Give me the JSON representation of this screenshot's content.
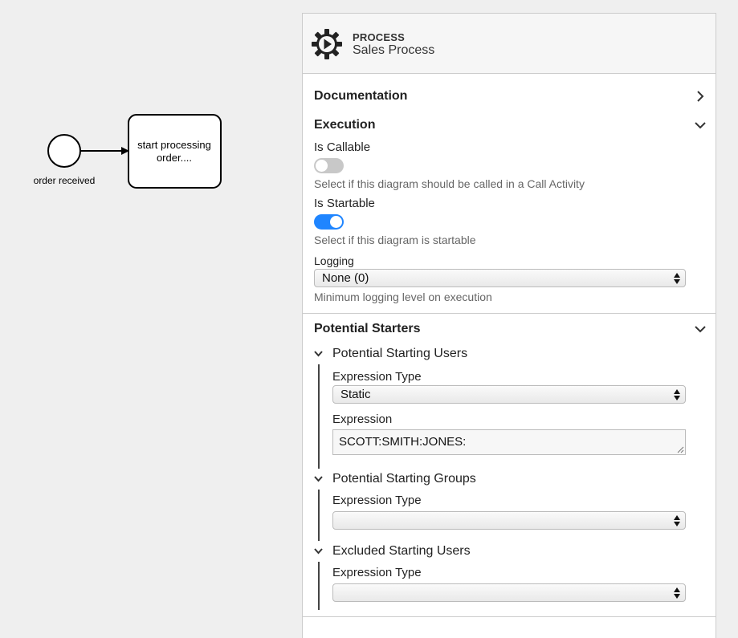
{
  "canvas": {
    "start_event_label": "order received",
    "task_label_line1": "start processing",
    "task_label_line2": "order...."
  },
  "panel": {
    "header": {
      "icon": "process-gear-icon",
      "type": "PROCESS",
      "name": "Sales Process"
    },
    "documentation": {
      "title": "Documentation",
      "icon": "chevron-right-icon"
    },
    "execution": {
      "title": "Execution",
      "icon": "chevron-down-icon",
      "is_callable": {
        "label": "Is Callable",
        "checked": false,
        "description": "Select if this diagram should be called in a Call Activity"
      },
      "is_startable": {
        "label": "Is Startable",
        "checked": true,
        "description": "Select if this diagram is startable"
      },
      "logging": {
        "label": "Logging",
        "value": "None (0)",
        "description": "Minimum logging level on execution"
      }
    },
    "potential_starters": {
      "title": "Potential Starters",
      "icon": "chevron-down-icon",
      "users": {
        "title": "Potential Starting Users",
        "expression_type_label": "Expression Type",
        "expression_type_value": "Static",
        "expression_label": "Expression",
        "expression_value": "SCOTT:SMITH:JONES:"
      },
      "groups": {
        "title": "Potential Starting Groups",
        "expression_type_label": "Expression Type",
        "expression_type_value": ""
      },
      "excluded": {
        "title": "Excluded Starting Users",
        "expression_type_label": "Expression Type",
        "expression_type_value": ""
      }
    }
  },
  "colors": {
    "toggle_on": "#1f85ff",
    "toggle_off": "#c8c8c8",
    "panel_header_bg": "#f6f6f6",
    "canvas_bg": "#efefef"
  }
}
